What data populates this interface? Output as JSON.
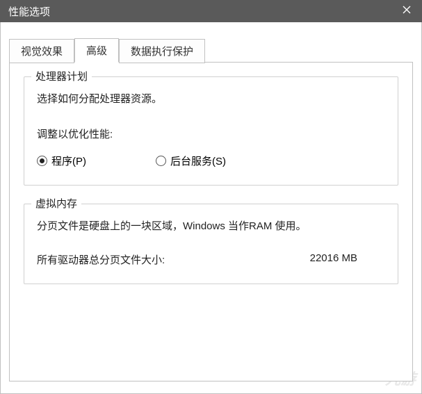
{
  "window": {
    "title": "性能选项"
  },
  "tabs": {
    "visual": "视觉效果",
    "advanced": "高级",
    "dep": "数据执行保护"
  },
  "processor": {
    "group_title": "处理器计划",
    "desc": "选择如何分配处理器资源。",
    "adjust_label": "调整以优化性能:",
    "radio_programs": "程序(P)",
    "radio_background": "后台服务(S)"
  },
  "vm": {
    "group_title": "虚拟内存",
    "desc": "分页文件是硬盘上的一块区域，Windows 当作RAM 使用。",
    "total_label": "所有驱动器总分页文件大小:",
    "total_value": "22016 MB"
  },
  "watermark": {
    "text": "九游"
  }
}
